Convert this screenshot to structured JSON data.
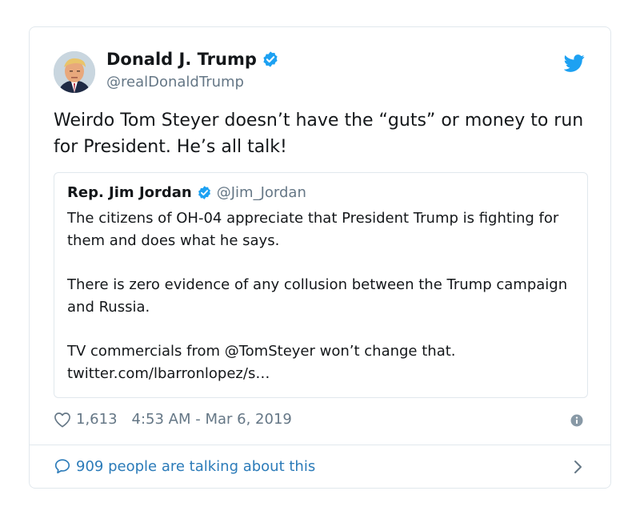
{
  "tweet": {
    "display_name": "Donald J. Trump",
    "handle": "@realDonaldTrump",
    "text": "Weirdo Tom Steyer doesn’t have the “guts” or money to run for President. He’s all talk!",
    "likes": "1,613",
    "timestamp": "4:53 AM - Mar 6, 2019",
    "conversation": "909 people are talking about this"
  },
  "quote": {
    "display_name": "Rep. Jim Jordan",
    "handle": "@Jim_Jordan",
    "paragraphs": [
      "The citizens of OH-04 appreciate that President Trump is fighting for them and does what he says.",
      "There is zero evidence of any collusion between the Trump campaign and Russia.",
      "TV commercials from @TomSteyer won’t change that. twitter.com/lbarronlopez/s…"
    ]
  },
  "icons": {
    "verified": "verified-badge-icon",
    "brand": "twitter-bird-icon",
    "like": "heart-icon",
    "info": "info-icon",
    "reply": "speech-bubble-icon",
    "more": "chevron-right-icon"
  },
  "colors": {
    "accent": "#1da1f2",
    "link": "#2b7bb9",
    "muted": "#657786",
    "text": "#14171a",
    "border": "#e1e8ed"
  }
}
